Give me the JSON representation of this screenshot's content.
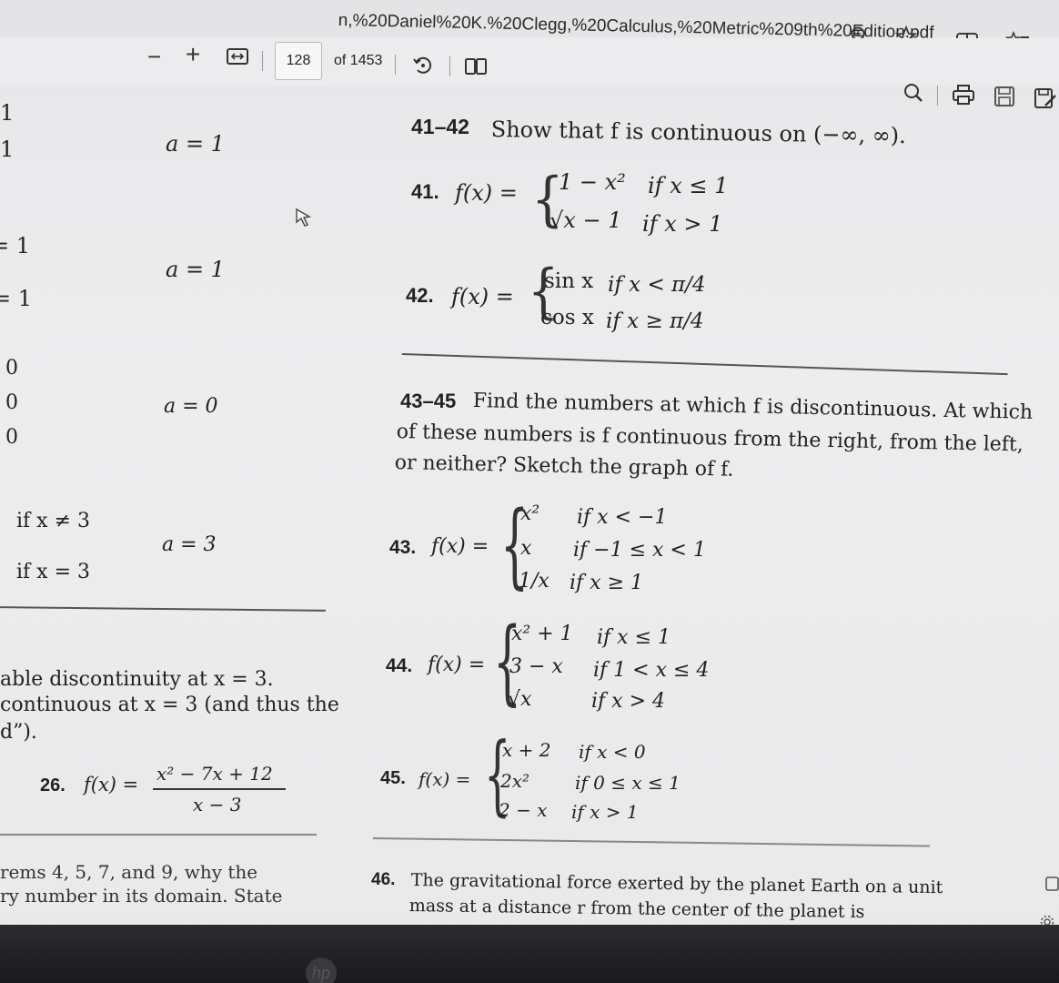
{
  "browser": {
    "url_text": "n,%20Daniel%20K.%20Clegg,%20Calculus,%20Metric%209th%20Edition.pdf",
    "zoom_icon": "zoom-search-icon",
    "favorite_icon": "star-icon",
    "split_icon": "split-screen-icon",
    "favorites_bar_icon": "favorites-list-icon"
  },
  "pdf_toolbar": {
    "zoom_out": "−",
    "zoom_in": "+",
    "fit_icon": "fit-width-icon",
    "current_page": "128",
    "page_total": "of 1453",
    "rotate_icon": "rotate-icon",
    "two_page_icon": "two-page-view-icon",
    "search_icon": "search-icon",
    "print_icon": "print-icon",
    "save_icon": "save-icon",
    "save_as_icon": "save-as-icon"
  },
  "left_column": {
    "edge_1a": "1",
    "edge_1b": "1",
    "edge_1c": "= 1",
    "edge_1d": "= 1",
    "edge_0a": "0",
    "edge_0b": "0",
    "edge_0c": "0",
    "a1": "a = 1",
    "a2": "a = 1",
    "a3": "a = 0",
    "a4": "a = 3",
    "case_1": "if x ≠ 3",
    "case_2": "if x = 3",
    "text_1": "able discontinuity at x = 3.",
    "text_2": "continuous at x = 3 (and thus the",
    "text_3": "d”).",
    "p26_label": "26.",
    "p26_fx": "f(x) =",
    "p26_num": "x² − 7x + 12",
    "p26_den": "x − 3",
    "bottom_1": "rems 4, 5, 7, and 9, why the",
    "bottom_2": "ry number in its domain. State"
  },
  "right_column": {
    "h41_num": "41–42",
    "h41_text": "Show that f is continuous on (−∞, ∞).",
    "p41_label": "41.",
    "p41_fx": "f(x) =",
    "p41_r1_expr": "1 − x²",
    "p41_r1_cond": "if x ≤ 1",
    "p41_r2_expr": "√x − 1",
    "p41_r2_cond": "if x > 1",
    "p42_label": "42.",
    "p42_fx": "f(x) =",
    "p42_r1_expr": "sin x",
    "p42_r1_cond": "if x < π/4",
    "p42_r2_expr": "cos x",
    "p42_r2_cond": "if x ≥ π/4",
    "h43_num": "43–45",
    "h43_line1": "Find the numbers at which f is discontinuous. At which",
    "h43_line2": "of these numbers is f continuous from the right, from the left,",
    "h43_line3": "or neither? Sketch the graph of f.",
    "p43_label": "43.",
    "p43_fx": "f(x) =",
    "p43_r1_expr": "x²",
    "p43_r1_cond": "if x < −1",
    "p43_r2_expr": "x",
    "p43_r2_cond": "if −1 ≤ x < 1",
    "p43_r3_expr": "1/x",
    "p43_r3_cond": "if x ≥ 1",
    "p44_label": "44.",
    "p44_fx": "f(x) =",
    "p44_r1_expr": "x² + 1",
    "p44_r1_cond": "if x ≤ 1",
    "p44_r2_expr": "3 − x",
    "p44_r2_cond": "if 1 < x ≤ 4",
    "p44_r3_expr": "√x",
    "p44_r3_cond": "if x > 4",
    "p45_label": "45.",
    "p45_fx": "f(x) =",
    "p45_r1_expr": "x + 2",
    "p45_r1_cond": "if x < 0",
    "p45_r2_expr": "2x²",
    "p45_r2_cond": "if 0 ≤ x ≤ 1",
    "p45_r3_expr": "2 − x",
    "p45_r3_cond": "if x > 1",
    "p46_label": "46.",
    "p46_line1": "The gravitational force exerted by the planet Earth on a unit",
    "p46_line2": "mass at a distance r from the center of the planet is"
  },
  "side_icons": {
    "sidebar_icon": "sidebar-square-icon",
    "settings_icon": "gear-icon"
  },
  "device": {
    "logo_text": "hp"
  }
}
